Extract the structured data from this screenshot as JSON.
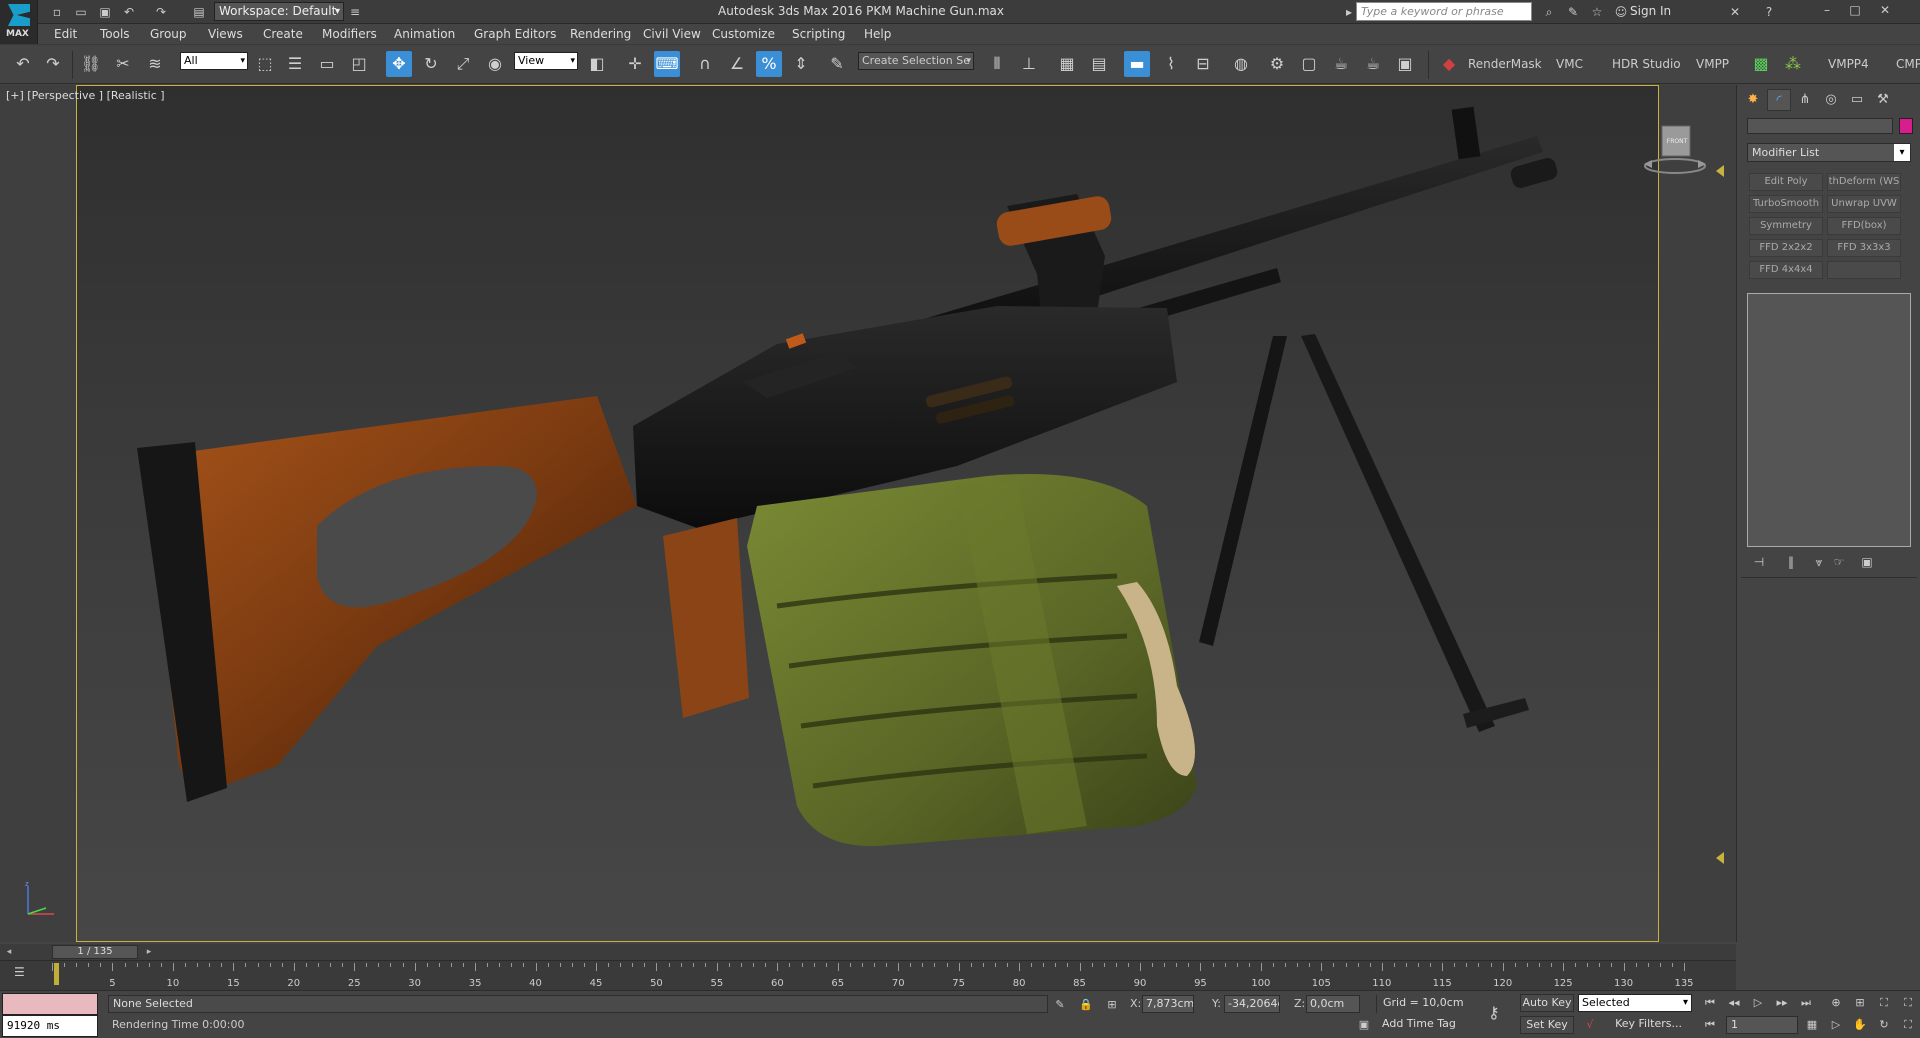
{
  "title_bar": {
    "logo_text": "MAX",
    "workspace": "Workspace: Default",
    "title": "Autodesk 3ds Max 2016     PKM Machine Gun.max",
    "search_placeholder": "Type a keyword or phrase",
    "sign_in": "Sign In"
  },
  "menu": [
    "Edit",
    "Tools",
    "Group",
    "Views",
    "Create",
    "Modifiers",
    "Animation",
    "Graph Editors",
    "Rendering",
    "Civil View",
    "Customize",
    "Scripting",
    "Help"
  ],
  "toolbar": {
    "filter_value": "All",
    "ref_coord_value": "View",
    "selection_set_value": "Create Selection Se",
    "plugins": [
      "RenderMask",
      "VMC",
      "HDR Studio",
      "VMPP",
      "VMPP4",
      "CMP"
    ]
  },
  "viewport": {
    "label": "[+] [Perspective ] [Realistic ]",
    "viewcube_face": "FRONT"
  },
  "command_panel": {
    "modifier_list_label": "Modifier List",
    "object_color": "#d81d8c",
    "modifier_buttons": [
      "Edit Poly",
      "thDeform (WS",
      "TurboSmooth",
      "Unwrap UVW",
      "Symmetry",
      "FFD(box)",
      "FFD 2x2x2",
      "FFD 3x3x3",
      "FFD 4x4x4",
      ""
    ]
  },
  "timeline": {
    "frame_display": "1 / 135",
    "ticks": [
      "5",
      "10",
      "15",
      "20",
      "25",
      "30",
      "35",
      "40",
      "45",
      "50",
      "55",
      "60",
      "65",
      "70",
      "75",
      "80",
      "85",
      "90",
      "95",
      "100",
      "105",
      "110",
      "115",
      "120",
      "125",
      "130",
      "135"
    ]
  },
  "status": {
    "maxscript_output": "91920 ms",
    "selection": "None Selected",
    "prompt": "Rendering Time  0:00:00",
    "x_label": "X:",
    "x_value": "7,873cm",
    "y_label": "Y:",
    "y_value": "-34,2064cm",
    "z_label": "Z:",
    "z_value": "0,0cm",
    "grid": "Grid = 10,0cm",
    "add_time_tag": "Add Time Tag",
    "auto_key": "Auto Key",
    "set_key": "Set Key",
    "selected_dd": "Selected",
    "key_filters": "Key Filters...",
    "current_frame": "1"
  }
}
